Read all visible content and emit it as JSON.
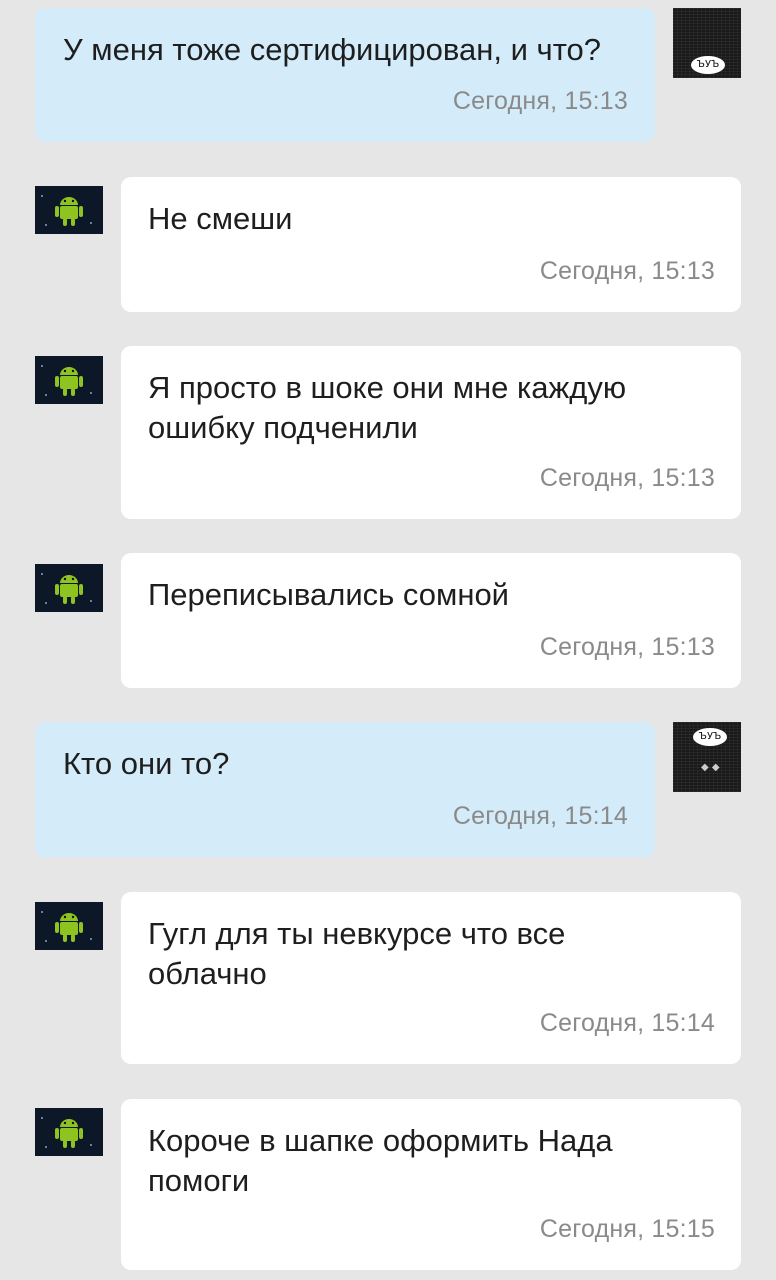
{
  "colors": {
    "background": "#e6e6e6",
    "outgoing_bubble": "#d4ecfa",
    "incoming_bubble": "#ffffff",
    "message_text": "#1e1e1e",
    "timestamp_text": "#8a8a8a",
    "android_avatar_bg": "#0c1728",
    "android_green": "#8fc31f"
  },
  "avatars": {
    "self": {
      "icon": "user-avatar-dark-photo",
      "sign_text": "ЪУЪ"
    },
    "other": {
      "icon": "android-robot-icon"
    }
  },
  "messages": [
    {
      "direction": "outgoing",
      "text": "У меня тоже сертифицирован, и что?",
      "time": "Сегодня, 15:13"
    },
    {
      "direction": "incoming",
      "text": "Не смеши",
      "time": "Сегодня, 15:13"
    },
    {
      "direction": "incoming",
      "text": "Я просто в шоке они мне каждую\nошибку подченили",
      "time": "Сегодня, 15:13"
    },
    {
      "direction": "incoming",
      "text": "Переписывались сомной",
      "time": "Сегодня, 15:13"
    },
    {
      "direction": "outgoing",
      "text": "Кто они то?",
      "time": "Сегодня, 15:14"
    },
    {
      "direction": "incoming",
      "text": "Гугл для ты невкурсе что все\nоблачно",
      "time": "Сегодня, 15:14"
    },
    {
      "direction": "incoming",
      "text": "Короче в шапке оформить Нада\nпомоги",
      "time": "Сегодня, 15:15"
    }
  ]
}
